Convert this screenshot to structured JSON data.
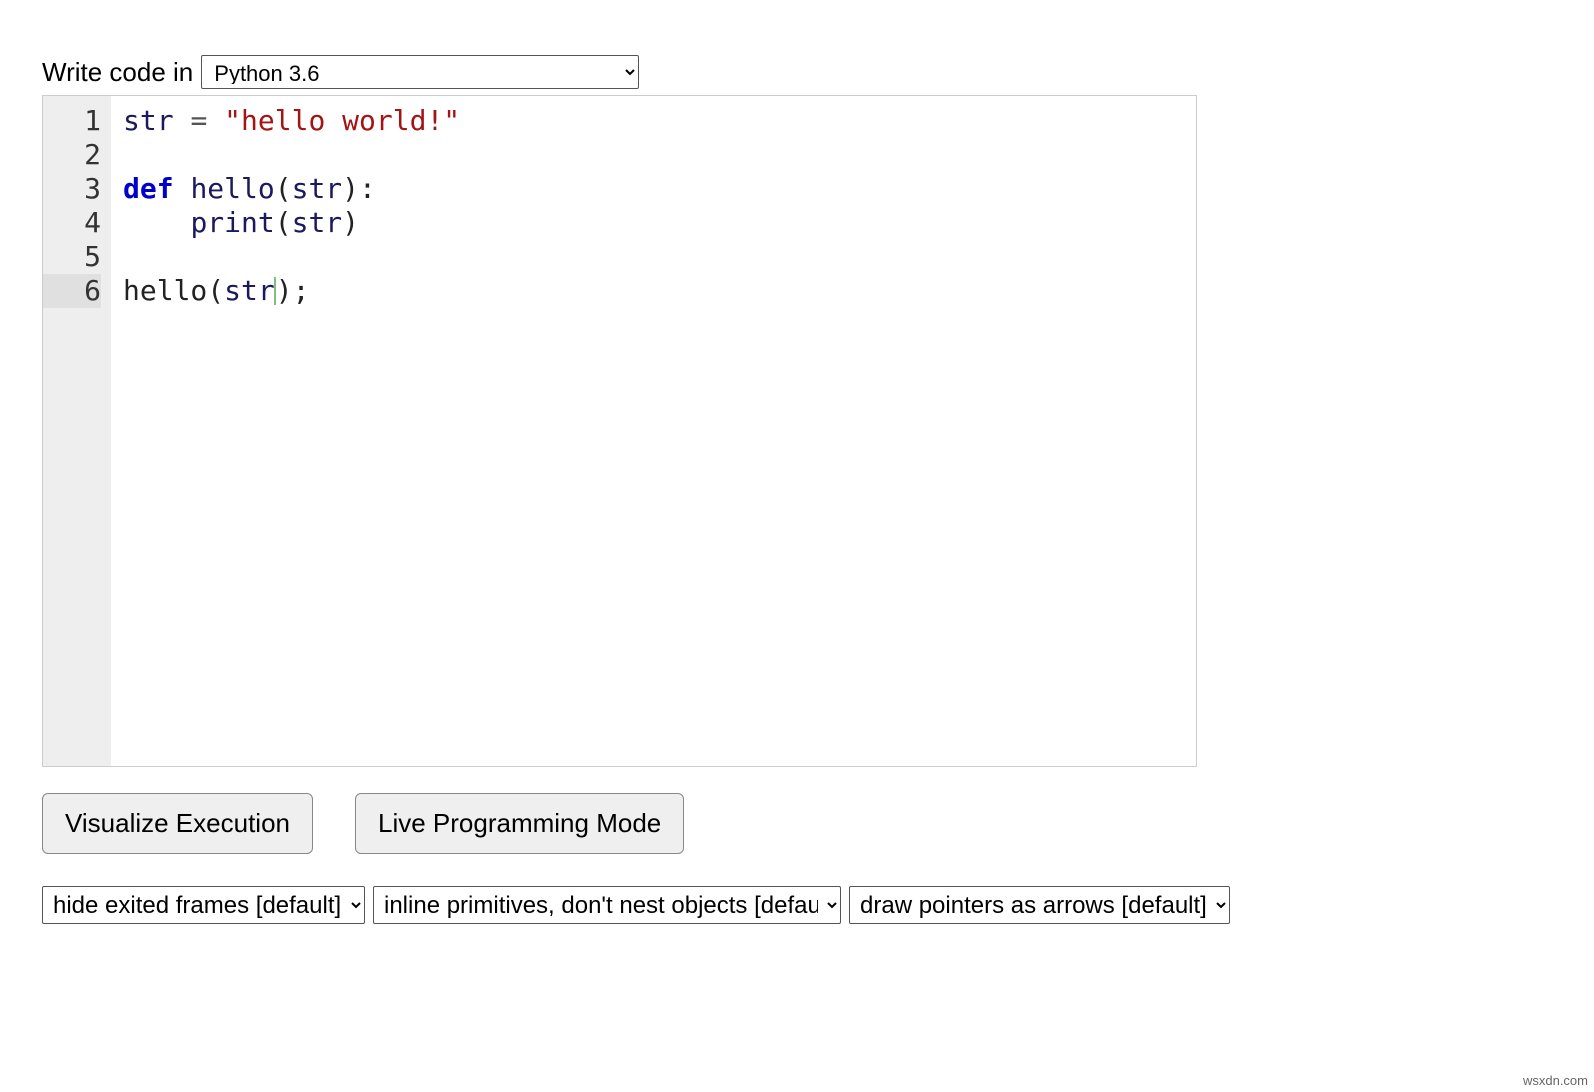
{
  "header": {
    "label": "Write code in",
    "language_selected": "Python 3.6"
  },
  "code": {
    "lines": [
      {
        "num": "1",
        "tokens": [
          {
            "t": "str",
            "c": "tok-var"
          },
          {
            "t": " "
          },
          {
            "t": "=",
            "c": "tok-op"
          },
          {
            "t": " "
          },
          {
            "t": "\"hello world!\"",
            "c": "tok-str"
          }
        ]
      },
      {
        "num": "2",
        "tokens": []
      },
      {
        "num": "3",
        "tokens": [
          {
            "t": "def",
            "c": "tok-kw"
          },
          {
            "t": " "
          },
          {
            "t": "hello",
            "c": "tok-def"
          },
          {
            "t": "(",
            "c": "tok-plain"
          },
          {
            "t": "str",
            "c": "tok-var"
          },
          {
            "t": "):",
            "c": "tok-plain"
          }
        ]
      },
      {
        "num": "4",
        "tokens": [
          {
            "t": "    "
          },
          {
            "t": "print",
            "c": "tok-builtin"
          },
          {
            "t": "(",
            "c": "tok-plain"
          },
          {
            "t": "str",
            "c": "tok-var"
          },
          {
            "t": ")",
            "c": "tok-plain"
          }
        ]
      },
      {
        "num": "5",
        "tokens": []
      },
      {
        "num": "6",
        "current": true,
        "tokens": [
          {
            "t": "hello",
            "c": "tok-plain"
          },
          {
            "t": "(",
            "c": "tok-plain"
          },
          {
            "t": "str",
            "c": "tok-var"
          },
          {
            "cursor": true
          },
          {
            "t": ");",
            "c": "tok-plain"
          }
        ]
      }
    ]
  },
  "buttons": {
    "visualize": "Visualize Execution",
    "live": "Live Programming Mode"
  },
  "options": {
    "frames": "hide exited frames [default]",
    "primitives": "inline primitives, don't nest objects [default]",
    "pointers": "draw pointers as arrows [default]"
  },
  "attribution": "wsxdn.com"
}
